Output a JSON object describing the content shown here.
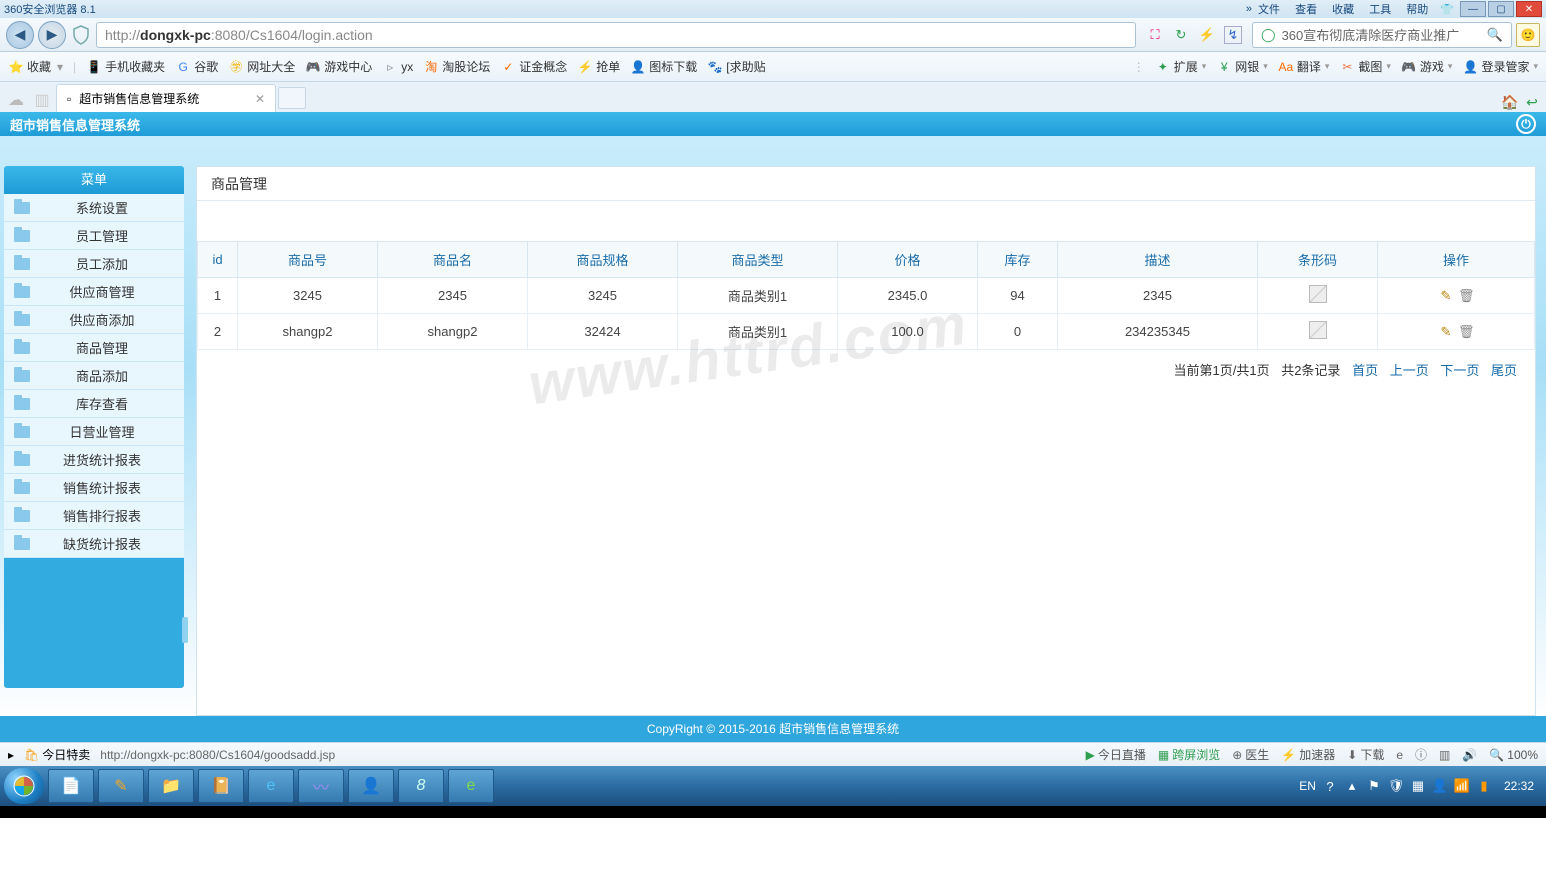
{
  "browser": {
    "title": "360安全浏览器 8.1",
    "menus": [
      "文件",
      "查看",
      "收藏",
      "工具",
      "帮助"
    ],
    "url_prefix": "http://",
    "url_host": "dongxk-pc",
    "url_rest": ":8080/Cs1604/login.action",
    "search_placeholder": "360宣布彻底清除医疗商业推广",
    "bookmarks_left": [
      {
        "icon": "⭐",
        "color": "#f5a623",
        "label": "收藏"
      },
      {
        "icon": "📱",
        "color": "#5aa9e6",
        "label": "手机收藏夹"
      },
      {
        "icon": "G",
        "color": "#4285f4",
        "label": "谷歌"
      },
      {
        "icon": "㊫",
        "color": "#f4b400",
        "label": "网址大全"
      },
      {
        "icon": "🎮",
        "color": "#888",
        "label": "游戏中心"
      },
      {
        "icon": "▹",
        "color": "#888",
        "label": "yx"
      },
      {
        "icon": "淘",
        "color": "#ff6a00",
        "label": "淘股论坛"
      },
      {
        "icon": "✓",
        "color": "#ff6a00",
        "label": "证金概念"
      },
      {
        "icon": "⚡",
        "color": "#4aa",
        "label": "抢单"
      },
      {
        "icon": "👤",
        "color": "#888",
        "label": "图标下载"
      },
      {
        "icon": "🐾",
        "color": "#6a5acd",
        "label": "[求助贴"
      }
    ],
    "bookmarks_right": [
      {
        "icon": "✦",
        "color": "#2e9e4f",
        "label": "扩展"
      },
      {
        "icon": "¥",
        "color": "#2e9e4f",
        "label": "网银"
      },
      {
        "icon": "Aa",
        "color": "#ff6a00",
        "label": "翻译"
      },
      {
        "icon": "✂",
        "color": "#e74",
        "label": "截图"
      },
      {
        "icon": "🎮",
        "color": "#5aa9e6",
        "label": "游戏"
      },
      {
        "icon": "👤",
        "color": "#5aa9e6",
        "label": "登录管家"
      }
    ],
    "tab_title": "超市销售信息管理系统"
  },
  "app": {
    "header": "超市销售信息管理系统",
    "menu_header": "菜单",
    "menu_items": [
      "系统设置",
      "员工管理",
      "员工添加",
      "供应商管理",
      "供应商添加",
      "商品管理",
      "商品添加",
      "库存查看",
      "日营业管理",
      "进货统计报表",
      "销售统计报表",
      "销售排行报表",
      "缺货统计报表"
    ],
    "content_title": "商品管理",
    "columns": [
      "id",
      "商品号",
      "商品名",
      "商品规格",
      "商品类型",
      "价格",
      "库存",
      "描述",
      "条形码",
      "操作"
    ],
    "rows": [
      {
        "id": "1",
        "no": "3245",
        "name": "2345",
        "spec": "3245",
        "type": "商品类别1",
        "price": "2345.0",
        "stock": "94",
        "desc": "2345"
      },
      {
        "id": "2",
        "no": "shangp2",
        "name": "shangp2",
        "spec": "32424",
        "type": "商品类别1",
        "price": "100.0",
        "stock": "0",
        "desc": "234235345"
      }
    ],
    "pager": {
      "info1": "当前第1页/共1页",
      "info2": "共2条记录",
      "first": "首页",
      "prev": "上一页",
      "next": "下一页",
      "last": "尾页"
    },
    "watermark": "www.httrd.com",
    "footer": "CopyRight © 2015-2016 超市销售信息管理系统"
  },
  "status": {
    "left_icon": "今日特卖",
    "url": "http://dongxk-pc:8080/Cs1604/goodsadd.jsp",
    "items": [
      {
        "icon": "▶",
        "label": "今日直播",
        "color": "#2e9e4f"
      },
      {
        "icon": "▦",
        "label": "跨屏浏览",
        "color": "#2e9e4f"
      },
      {
        "icon": "⊕",
        "label": "医生",
        "color": "#666"
      },
      {
        "icon": "⚡",
        "label": "加速器",
        "color": "#666"
      },
      {
        "icon": "⬇",
        "label": "下载",
        "color": "#666"
      },
      {
        "icon": "e",
        "label": "",
        "color": "#666"
      },
      {
        "icon": "ⓘ",
        "label": "",
        "color": "#666"
      },
      {
        "icon": "▥",
        "label": "",
        "color": "#666"
      },
      {
        "icon": "🔊",
        "label": "",
        "color": "#666"
      },
      {
        "icon": "🔍",
        "label": "100%",
        "color": "#666"
      }
    ]
  },
  "taskbar": {
    "lang": "EN",
    "time": "22:32"
  }
}
